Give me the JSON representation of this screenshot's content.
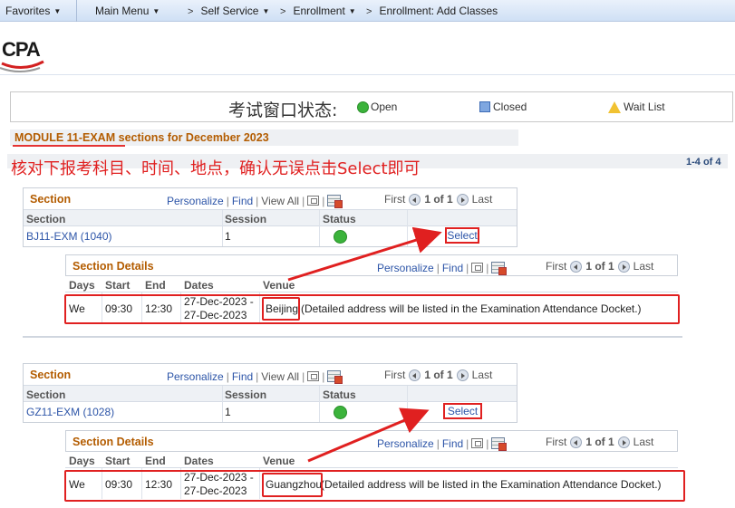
{
  "nav": {
    "favorites": "Favorites",
    "main_menu": "Main Menu",
    "breadcrumbs": [
      "Self Service",
      "Enrollment",
      "Enrollment: Add Classes"
    ]
  },
  "logo": {
    "text": "CPA"
  },
  "legend": {
    "title": "考试窗口状态:",
    "open": "Open",
    "closed": "Closed",
    "wait_list": "Wait List"
  },
  "module": {
    "code": "MODULE 11-EXAM",
    "suffix": " sections for December 2023"
  },
  "instruction": "核对下报考科目、时间、地点，确认无误点击Select即可",
  "pager_count": "1-4 of 4",
  "grid_labels": {
    "section_title": "Section",
    "details_title": "Section Details",
    "personalize": "Personalize",
    "find": "Find",
    "view_all": "View All",
    "first": "First",
    "page": "1 of 1",
    "last": "Last",
    "col_section": "Section",
    "col_session": "Session",
    "col_status": "Status",
    "col_days": "Days",
    "col_start": "Start",
    "col_end": "End",
    "col_dates": "Dates",
    "col_venue": "Venue",
    "select": "Select"
  },
  "sections": [
    {
      "section": "BJ11-EXM (1040)",
      "session": "1",
      "days": "We",
      "start": "09:30",
      "end": "12:30",
      "date_start": "27-Dec-2023 -",
      "date_end": "27-Dec-2023",
      "venue": "Beijing",
      "venue_note": "(Detailed address will be listed in the Examination Attendance Docket.)"
    },
    {
      "section": "GZ11-EXM (1028)",
      "session": "1",
      "days": "We",
      "start": "09:30",
      "end": "12:30",
      "date_start": "27-Dec-2023 -",
      "date_end": "27-Dec-2023",
      "venue": "Guangzhou",
      "venue_note": "(Detailed address will be listed in the Examination Attendance Docket.)"
    }
  ],
  "colors": {
    "accent_orange": "#b35c00",
    "link_blue": "#2d55a8",
    "annotation_red": "#e02020",
    "status_green": "#3bb33b"
  }
}
